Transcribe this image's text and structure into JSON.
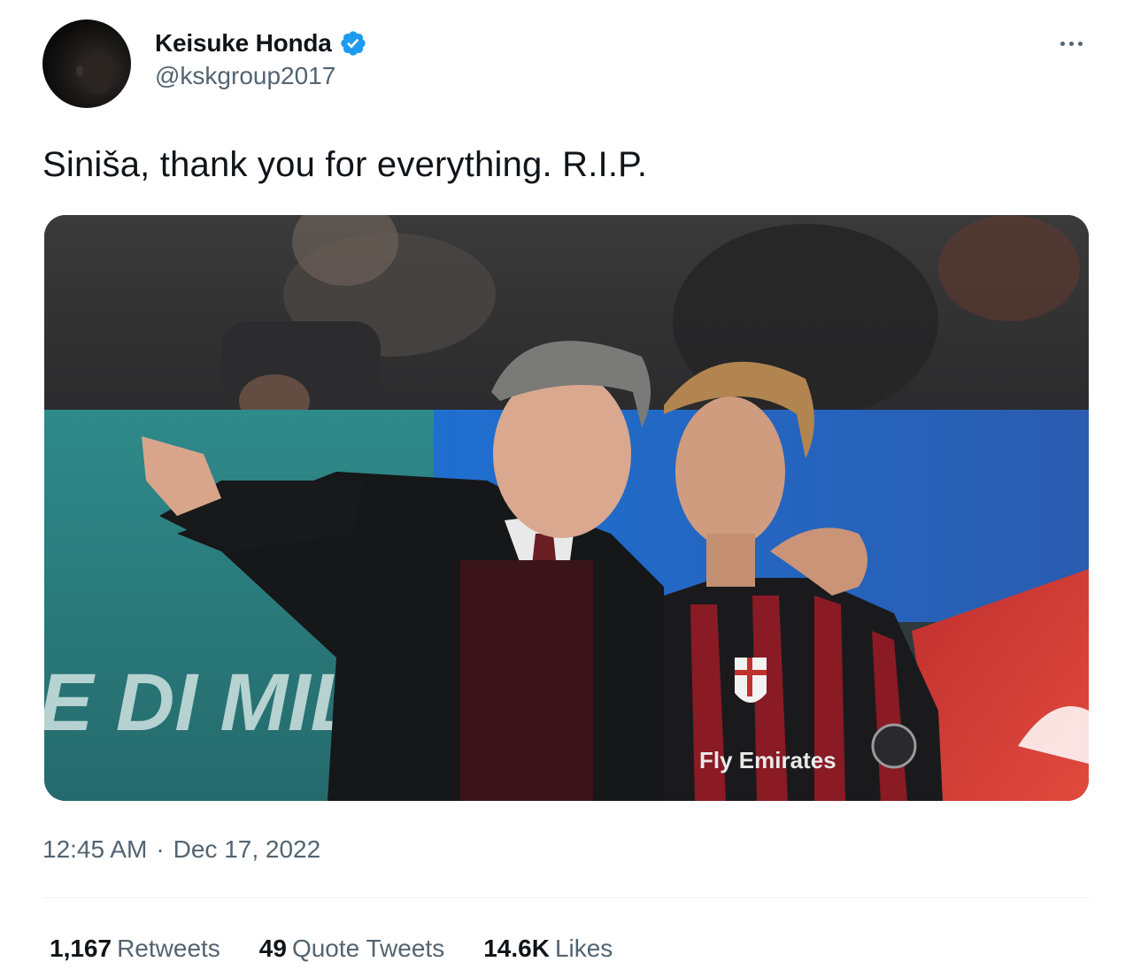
{
  "author": {
    "display_name": "Keisuke Honda",
    "handle": "@kskgroup2017",
    "verified": true,
    "avatar_icon": "profile-avatar"
  },
  "tweet": {
    "text": "Siniša, thank you for everything. R.I.P.",
    "time": "12:45 AM",
    "separator": "·",
    "date": "Dec 17, 2022"
  },
  "media": {
    "banner_text": "E DI MILANO",
    "shirt_text": "Fly Emirates"
  },
  "stats": [
    {
      "count": "1,167",
      "label": "Retweets"
    },
    {
      "count": "49",
      "label": "Quote Tweets"
    },
    {
      "count": "14.6K",
      "label": "Likes"
    }
  ],
  "icons": {
    "more": "more-options-icon",
    "verified": "verified-badge-icon"
  },
  "colors": {
    "verified_blue": "#1d9bf0",
    "secondary_text": "#536471",
    "primary_text": "#0f1419"
  }
}
